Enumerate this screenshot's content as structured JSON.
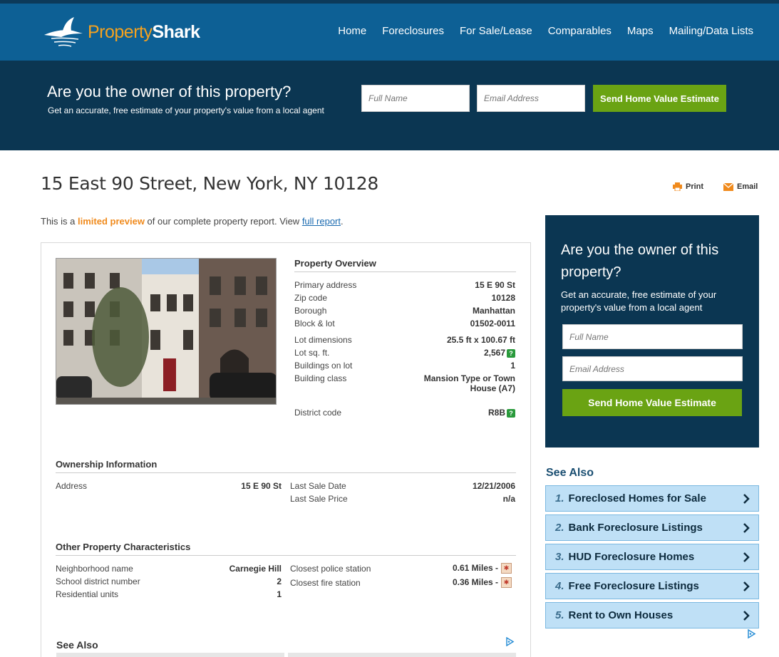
{
  "header": {
    "logo_property": "Property",
    "logo_shark": "Shark",
    "nav": [
      "Home",
      "Foreclosures",
      "For Sale/Lease",
      "Comparables",
      "Maps",
      "Mailing/Data Lists"
    ]
  },
  "banner": {
    "title": "Are you the owner of this property?",
    "subtitle": "Get an accurate, free estimate of your property's value from a local agent",
    "name_placeholder": "Full Name",
    "email_placeholder": "Email Address",
    "button": "Send Home Value Estimate"
  },
  "page": {
    "address": "15 East 90 Street, New York, NY 10128",
    "print": "Print",
    "email": "Email",
    "preview_prefix": "This is a ",
    "preview_highlight": "limited preview",
    "preview_middle": " of our complete property report. View ",
    "preview_link": "full report",
    "preview_suffix": "."
  },
  "overview": {
    "title": "Property Overview",
    "rows": [
      {
        "label": "Primary address",
        "value": "15 E 90 St"
      },
      {
        "label": "Zip code",
        "value": "10128"
      },
      {
        "label": "Borough",
        "value": "Manhattan"
      },
      {
        "label": "Block & lot",
        "value": "01502-0011"
      },
      {
        "label": "Lot dimensions",
        "value": "25.5 ft x 100.67 ft"
      },
      {
        "label": "Lot sq. ft.",
        "value": "2,567"
      },
      {
        "label": "Buildings on lot",
        "value": "1"
      },
      {
        "label": "Building class",
        "value": "Mansion Type or Town House (A7)"
      },
      {
        "label": "District code",
        "value": "R8B"
      }
    ],
    "help_glyph": "?"
  },
  "ownership": {
    "title": "Ownership Information",
    "address_label": "Address",
    "address_value": "15 E 90 St",
    "sale_date_label": "Last Sale Date",
    "sale_date_value": "12/21/2006",
    "sale_price_label": "Last Sale Price",
    "sale_price_value": "n/a"
  },
  "characteristics": {
    "title": "Other Property Characteristics",
    "left": [
      {
        "label": "Neighborhood name",
        "value": "Carnegie Hill"
      },
      {
        "label": "School district number",
        "value": "2"
      },
      {
        "label": "Residential units",
        "value": "1"
      }
    ],
    "right": [
      {
        "label": "Closest police station",
        "value": "0.61 Miles -"
      },
      {
        "label": "Closest fire station",
        "value": "0.36 Miles -"
      }
    ]
  },
  "report_see_also": "See Also",
  "sidebar": {
    "title": "Are you the owner of this property?",
    "subtitle": "Get an accurate, free estimate of your property's value from a local agent",
    "name_placeholder": "Full Name",
    "email_placeholder": "Email Address",
    "button": "Send Home Value Estimate",
    "see_also": "See Also",
    "links": [
      {
        "num": "1.",
        "label": "Foreclosed Homes for Sale"
      },
      {
        "num": "2.",
        "label": "Bank Foreclosure Listings"
      },
      {
        "num": "3.",
        "label": "HUD Foreclosure Homes"
      },
      {
        "num": "4.",
        "label": "Free Foreclosure Listings"
      },
      {
        "num": "5.",
        "label": "Rent to Own Houses"
      }
    ]
  },
  "colors": {
    "header": "#0d6095",
    "banner": "#0b3652",
    "button_green": "#6aa313",
    "accent_orange": "#f08a1c",
    "link_bg": "#bfe0f6"
  }
}
